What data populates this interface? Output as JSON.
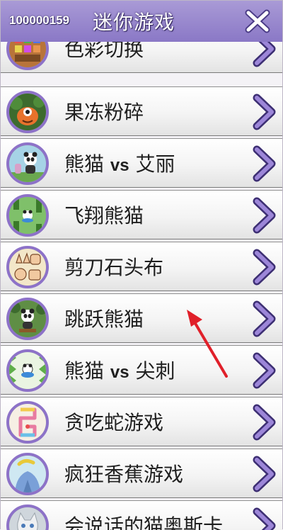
{
  "header": {
    "user_id": "100000159",
    "title": "迷你游戏",
    "close_icon": "close-x-icon"
  },
  "list": {
    "items": [
      {
        "label": "色彩切换",
        "icon": "color-switch-thumbnail"
      },
      {
        "label": "果冻粉碎",
        "icon": "jelly-crush-thumbnail"
      },
      {
        "label_pre": "熊猫 ",
        "label_vs": "vs",
        "label_post": " 艾丽",
        "icon": "panda-vs-ailly-thumbnail"
      },
      {
        "label": "飞翔熊猫",
        "icon": "flying-panda-thumbnail"
      },
      {
        "label": "剪刀石头布",
        "icon": "rock-paper-scissors-thumbnail"
      },
      {
        "label": "跳跃熊猫",
        "icon": "jumping-panda-thumbnail"
      },
      {
        "label_pre": "熊猫 ",
        "label_vs": "vs",
        "label_post": " 尖刺",
        "icon": "panda-vs-spikes-thumbnail"
      },
      {
        "label": "贪吃蛇游戏",
        "icon": "snake-game-thumbnail"
      },
      {
        "label": "疯狂香蕉游戏",
        "icon": "crazy-banana-thumbnail"
      },
      {
        "label": "会说话的猫奥斯卡",
        "icon": "talking-cat-oscar-thumbnail"
      }
    ]
  },
  "colors": {
    "header": "#8a78c6",
    "accent_purple": "#8d72c8",
    "annotation_arrow": "#e0202a"
  }
}
